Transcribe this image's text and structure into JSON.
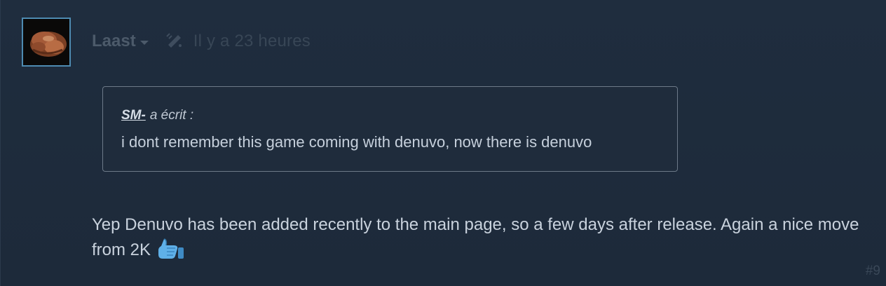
{
  "post": {
    "author": "Laast",
    "timestamp": "Il y a 23 heures",
    "quote": {
      "author": "SM-",
      "says": "a écrit :",
      "text": "i dont remember this game coming with denuvo, now there is denuvo"
    },
    "body": "Yep Denuvo has been added recently to the main page, so a few days after release. Again a nice move from 2K",
    "emoticon": "thumbs-up-icon",
    "number": "#9"
  },
  "colors": {
    "background": "#1e2a39",
    "avatar_border": "#4e8bb1",
    "text": "#c9d2dd",
    "muted": "#4c5a6a",
    "quote_border": "#6d7a89",
    "emoticon": "#5fb0e8"
  }
}
